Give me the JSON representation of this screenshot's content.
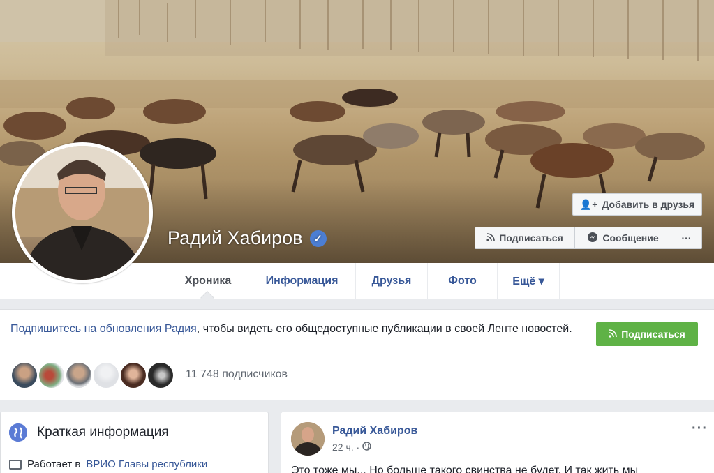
{
  "profile": {
    "name": "Радий Хабиров",
    "verified_icon": "verified-check-icon"
  },
  "cover_actions": {
    "add_friend_label": "Добавить в друзья",
    "subscribe_label": "Подписаться",
    "message_label": "Сообщение",
    "more_label": "···"
  },
  "nav": {
    "tabs": [
      {
        "label": "Хроника"
      },
      {
        "label": "Информация"
      },
      {
        "label": "Друзья"
      },
      {
        "label": "Фото"
      },
      {
        "label": "Ещё ▾"
      }
    ]
  },
  "follow_banner": {
    "link_text": "Подпишитесь на обновления Радия",
    "rest_text": ", чтобы видеть его общедоступные публикации в своей Ленте новостей.",
    "button_label": "Подписаться",
    "followers_count": "11 748 подписчиков"
  },
  "intro": {
    "title": "Краткая информация",
    "works_prefix": "Работает в",
    "works_link": "ВРИО Главы республики"
  },
  "post": {
    "author": "Радий Хабиров",
    "time": "22 ч. ·",
    "more": "···",
    "text": "Это тоже мы... Но больше такого свинства не будет. И так жить мы"
  },
  "colors": {
    "link": "#385898",
    "follow_button": "#5fb246",
    "verified": "#4c7ed3"
  }
}
